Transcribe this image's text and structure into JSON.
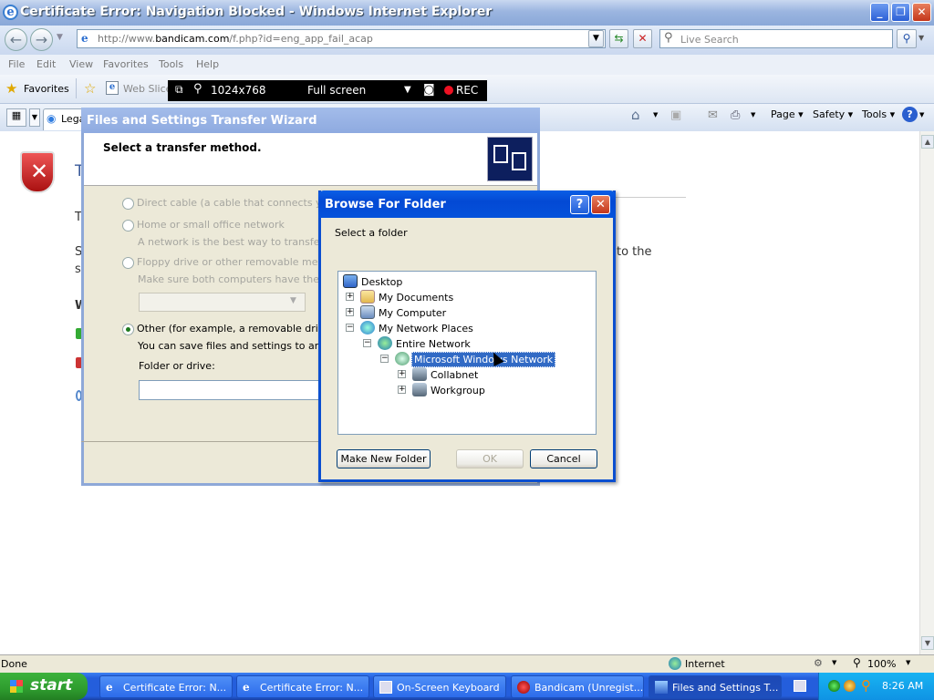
{
  "ie": {
    "title": "Certificate Error: Navigation Blocked - Windows Internet Explorer",
    "url_prefix": "http://www.",
    "url_host": "bandicam.com",
    "url_rest": "/f.php?id=eng_app_fail_acap",
    "search_placeholder": "Live Search",
    "menu": [
      "File",
      "Edit",
      "View",
      "Favorites",
      "Tools",
      "Help"
    ],
    "favorites_label": "Favorites",
    "web_slice_label": "Web Slice",
    "tab_label": "Lega",
    "commands": {
      "page": "Page",
      "safety": "Safety",
      "tools": "Tools"
    },
    "status_text": "Done",
    "zone": "Internet",
    "zoom": "100%"
  },
  "bandicam": {
    "resolution": "1024x768",
    "mode": "Full screen",
    "rec": "REC"
  },
  "page_bg": {
    "title_frag": "T",
    "line1_frag": "T",
    "line2_frag": "S",
    "line2b_frag": "s",
    "heading_frag": "W",
    "right_text": "to the"
  },
  "wizard": {
    "title": "Files and Settings Transfer Wizard",
    "heading": "Select a transfer method.",
    "options": [
      {
        "label": "Direct cable (a cable that connects your c",
        "desc": ""
      },
      {
        "label": "Home or small office network",
        "desc": "A network is the best way to transfer large"
      },
      {
        "label": "Floppy drive or other removable media",
        "desc": "Make sure both computers have the same"
      },
      {
        "label": "Other (for example, a removable drive or ne",
        "desc": "You can save files and settings to any disk"
      }
    ],
    "folder_label": "Folder or drive:"
  },
  "browse": {
    "title": "Browse For Folder",
    "prompt": "Select a folder",
    "tree": [
      {
        "label": "Desktop"
      },
      {
        "label": "My Documents"
      },
      {
        "label": "My Computer"
      },
      {
        "label": "My Network Places"
      },
      {
        "label": "Entire Network"
      },
      {
        "label": "Microsoft Windows Network"
      },
      {
        "label": "Collabnet"
      },
      {
        "label": "Workgroup"
      }
    ],
    "buttons": {
      "new_folder": "Make New Folder",
      "ok": "OK",
      "cancel": "Cancel"
    }
  },
  "taskbar": {
    "start": "start",
    "tasks": [
      "Certificate Error: N...",
      "Certificate Error: N...",
      "On-Screen Keyboard",
      "Bandicam (Unregist...",
      "Files and Settings T..."
    ],
    "clock": "8:26 AM"
  }
}
